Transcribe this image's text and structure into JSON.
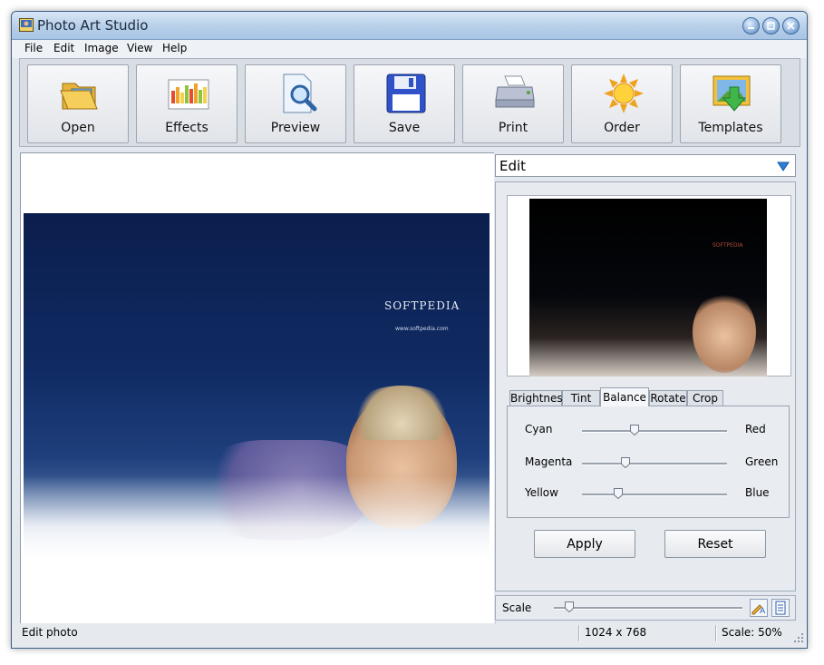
{
  "window": {
    "title": "Photo Art Studio"
  },
  "menu": [
    "File",
    "Edit",
    "Image",
    "View",
    "Help"
  ],
  "toolbar": {
    "buttons": [
      {
        "label": "Open",
        "icon": "folder-open-icon"
      },
      {
        "label": "Effects",
        "icon": "effects-chart-icon"
      },
      {
        "label": "Preview",
        "icon": "magnifier-page-icon"
      },
      {
        "label": "Save",
        "icon": "floppy-disk-icon"
      },
      {
        "label": "Print",
        "icon": "printer-icon"
      },
      {
        "label": "Order",
        "icon": "sun-icon"
      },
      {
        "label": "Templates",
        "icon": "download-arrow-icon"
      }
    ]
  },
  "image": {
    "brand_text": "SOFTPEDIA",
    "url_text": "www.softpedia.com"
  },
  "thumbnail": {
    "brand_text": "SOFTPEDIA"
  },
  "side_panel": {
    "mode": "Edit",
    "tabs": [
      "Brightness",
      "Tint",
      "Balance",
      "Rotate",
      "Crop"
    ],
    "active_tab": "Balance",
    "sliders": [
      {
        "left": "Cyan",
        "right": "Red",
        "value": 0.36
      },
      {
        "left": "Magenta",
        "right": "Green",
        "value": 0.3
      },
      {
        "left": "Yellow",
        "right": "Blue",
        "value": 0.25
      }
    ],
    "apply_label": "Apply",
    "reset_label": "Reset",
    "scale_label": "Scale",
    "scale_value": 0.08
  },
  "statusbar": {
    "message": "Edit photo",
    "dimensions": "1024 x 768",
    "scale": "Scale: 50%"
  }
}
